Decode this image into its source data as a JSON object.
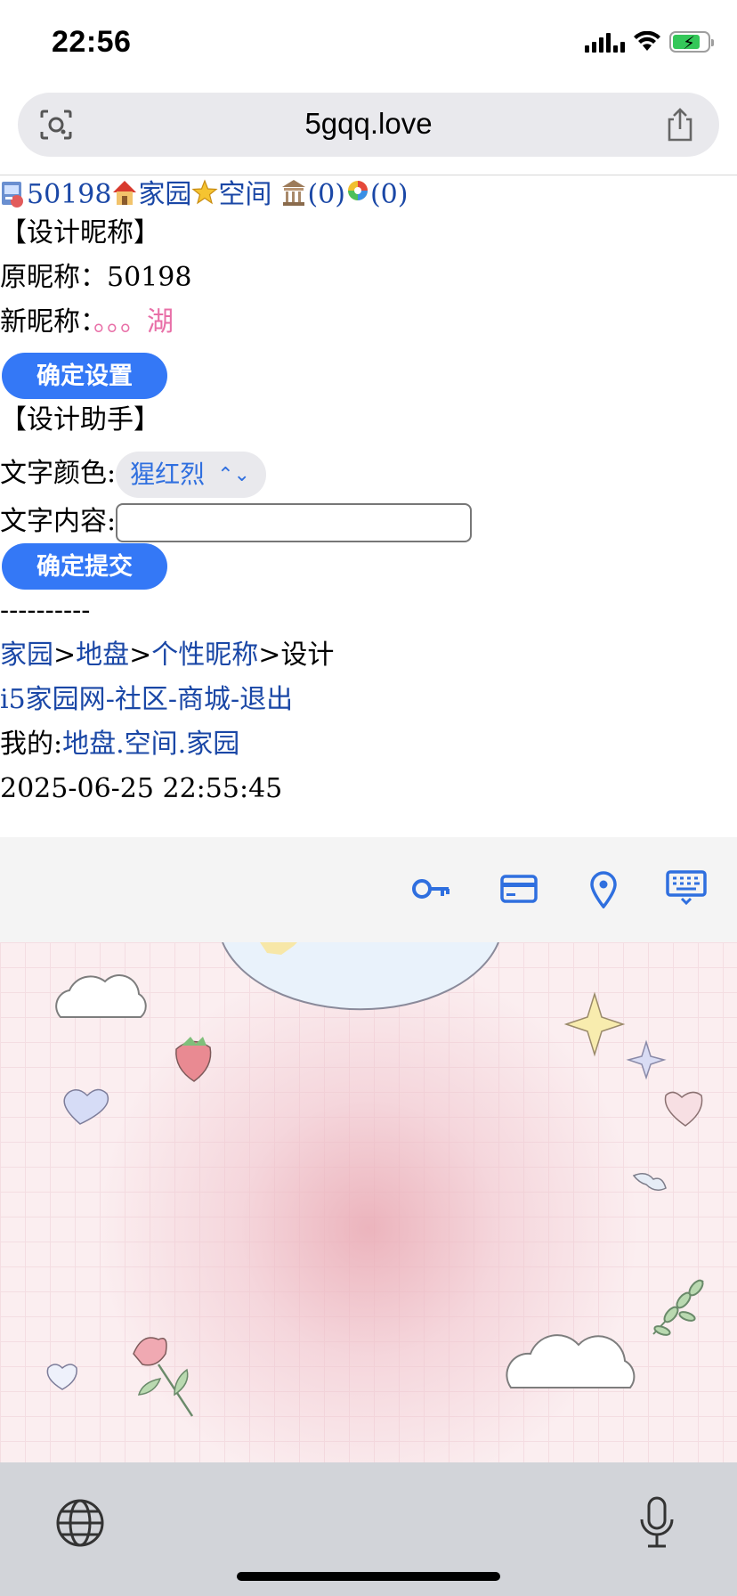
{
  "status_bar": {
    "time": "22:56"
  },
  "browser": {
    "url": "5gqq.love"
  },
  "nav": {
    "user_id": "50198",
    "home": "家园",
    "space": "空间",
    "count1": "(0)",
    "count2": "(0)"
  },
  "nickname_section": {
    "title": "【设计昵称】",
    "original_label": "原昵称：",
    "original_value": "50198",
    "new_label": "新昵称：",
    "new_value": "。。。湖",
    "confirm_button": "确定设置"
  },
  "assistant_section": {
    "title": "【设计助手】",
    "color_label": "文字颜色:",
    "color_selected": "猩红烈",
    "content_label": "文字内容:",
    "content_value": "",
    "submit_button": "确定提交"
  },
  "footer": {
    "divider": "----------",
    "breadcrumb": [
      "家园",
      "地盘",
      "个性昵称",
      "设计"
    ],
    "breadcrumb_sep": ">",
    "site_links": [
      "i5家园网",
      "社区",
      "商城",
      "退出"
    ],
    "site_sep": "-",
    "my_label": "我的:",
    "my_links": [
      "地盘",
      "空间",
      "家园"
    ],
    "my_sep": ".",
    "timestamp": "2025-06-25 22:55:45"
  },
  "colors": {
    "link": "#1a47a6",
    "button": "#3478f6",
    "nickname_preview": "#e86fa7"
  }
}
